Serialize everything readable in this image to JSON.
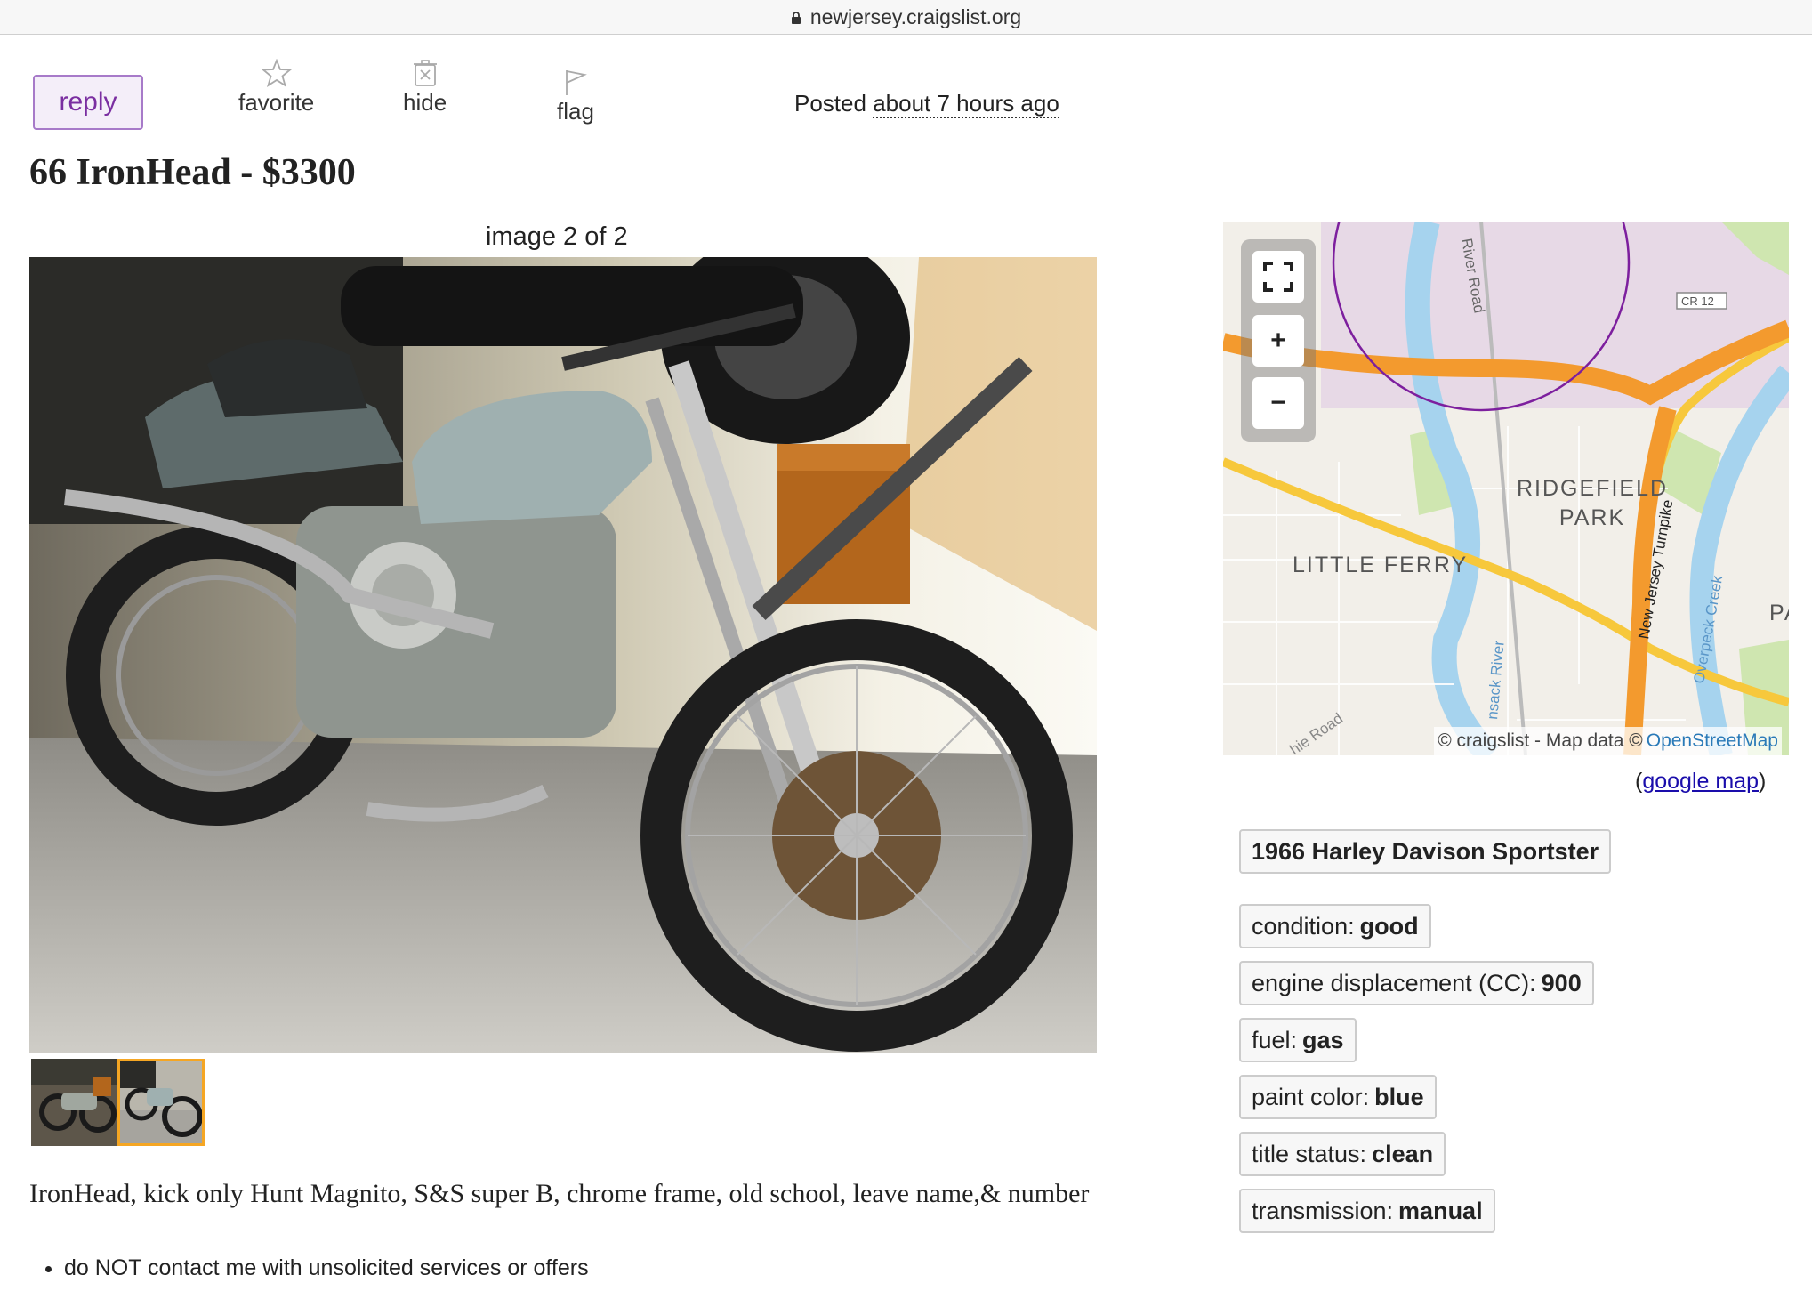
{
  "browser": {
    "url": "newjersey.craigslist.org"
  },
  "actions": {
    "reply": "reply",
    "favorite": "favorite",
    "hide": "hide",
    "flag": "flag"
  },
  "posted": {
    "label": "Posted",
    "ago": "about 7 hours ago"
  },
  "title": "66 IronHead - $3300",
  "gallery": {
    "caption": "image 2 of 2",
    "thumbnail_count": 2,
    "selected_thumbnail": 2
  },
  "body_text": "IronHead, kick only Hunt Magnito, S&S super B, chrome frame, old school, leave name,& number",
  "notices": [
    "do NOT contact me with unsolicited services or offers"
  ],
  "map": {
    "places": {
      "ridgefield_park_1": "RIDGEFIELD",
      "ridgefield_park_2": "PARK",
      "little_ferry": "LITTLE FERRY",
      "edge": "PA"
    },
    "roads": {
      "river_road": "River Road",
      "njt": "New Jersey Turnpike",
      "overpeck": "Overpeck Creek",
      "hackensack": "nsack River",
      "hie_road": "hie Road",
      "cr": "CR 12"
    },
    "controls": {
      "fullscreen_icon": "fullscreen-icon",
      "zoom_in": "+",
      "zoom_out": "−"
    },
    "attribution": {
      "text": "© craigslist - Map data ©",
      "link": "OpenStreetMap"
    },
    "google_open": "(",
    "google_link": "google map",
    "google_close": ")",
    "colors": {
      "highway": "#f39a2e",
      "major_road": "#f7c83c",
      "water": "#a6d3ee",
      "park": "#cfe6b0",
      "circle": "#7d1f9e",
      "area": "#e7d9e6"
    }
  },
  "attributes": {
    "model": "1966 Harley Davison Sportster",
    "items": [
      {
        "label": "condition:",
        "value": "good"
      },
      {
        "label": "engine displacement (CC):",
        "value": "900"
      },
      {
        "label": "fuel:",
        "value": "gas"
      },
      {
        "label": "paint color:",
        "value": "blue"
      },
      {
        "label": "title status:",
        "value": "clean"
      },
      {
        "label": "transmission:",
        "value": "manual"
      }
    ]
  },
  "colors": {
    "accent": "#7a2ea1",
    "selected_thumb": "#f5a623"
  }
}
